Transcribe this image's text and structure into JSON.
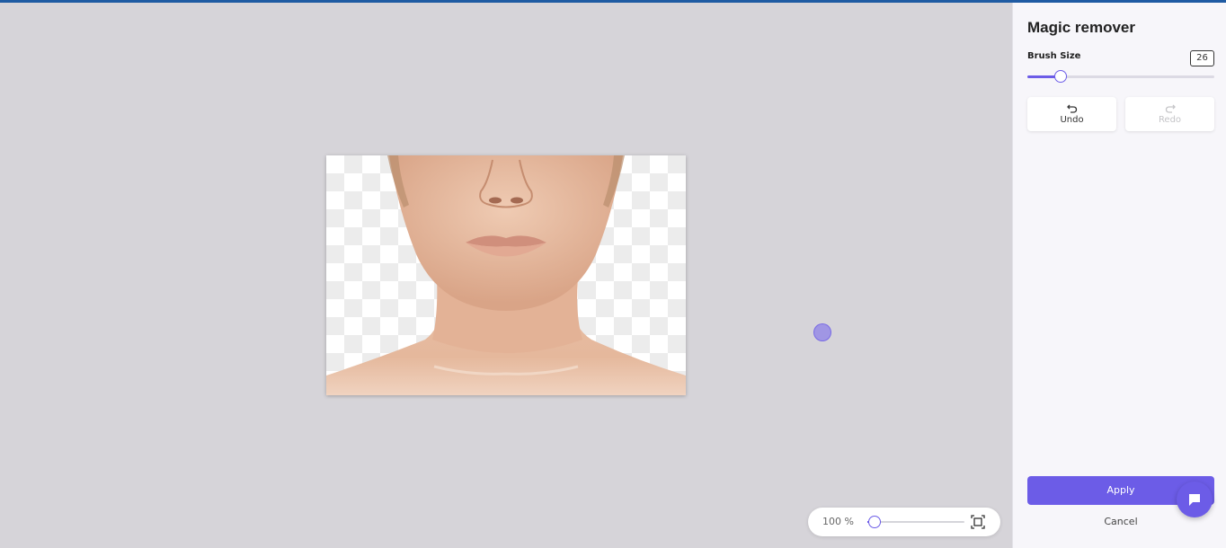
{
  "panel": {
    "title": "Magic remover",
    "brush_size": {
      "label": "Brush Size",
      "value": "26",
      "fraction": 0.18
    },
    "undo_label": "Undo",
    "redo_label": "Redo",
    "apply_label": "Apply",
    "cancel_label": "Cancel"
  },
  "zoom": {
    "label": "100 %",
    "fraction": 0.07
  },
  "icons": {
    "undo": "undo-icon",
    "redo": "redo-icon",
    "fit": "fit-to-screen-icon",
    "chat": "chat-icon"
  },
  "colors": {
    "accent": "#6c5ce7",
    "top_bar": "#1f5ba3",
    "canvas_bg": "#d6d4d9",
    "panel_bg": "#f7f6fa"
  }
}
